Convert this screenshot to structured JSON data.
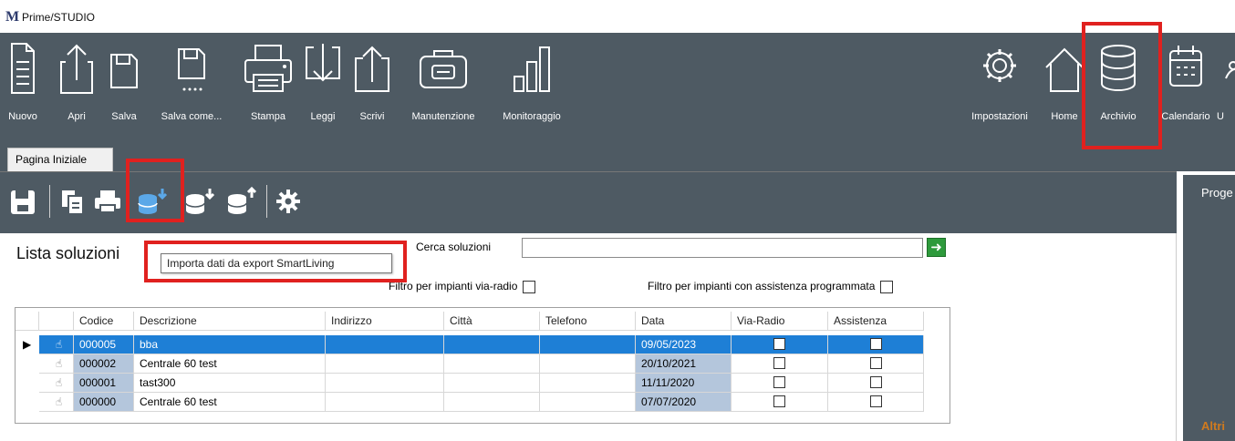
{
  "app": {
    "logo": "M",
    "title": "Prime/STUDIO"
  },
  "ribbon": {
    "left": [
      {
        "label": "Nuovo",
        "icon": "new-document-icon"
      },
      {
        "label": "Apri",
        "icon": "open-icon"
      },
      {
        "label": "Salva",
        "icon": "save-icon"
      },
      {
        "label": "Salva come...",
        "icon": "save-as-icon"
      },
      {
        "label": "Stampa",
        "icon": "printer-icon"
      },
      {
        "label": "Leggi",
        "icon": "read-icon"
      },
      {
        "label": "Scrivi",
        "icon": "write-icon"
      },
      {
        "label": "Manutenzione",
        "icon": "toolbox-icon"
      },
      {
        "label": "Monitoraggio",
        "icon": "bar-chart-icon"
      }
    ],
    "right": [
      {
        "label": "Impostazioni",
        "icon": "gear-icon"
      },
      {
        "label": "Home",
        "icon": "home-icon"
      },
      {
        "label": "Archivio",
        "icon": "database-icon"
      },
      {
        "label": "Calendario",
        "icon": "calendar-icon"
      },
      {
        "label": "U",
        "icon": "user-icon"
      }
    ]
  },
  "tabs": {
    "active": "Pagina Iniziale"
  },
  "toolbar2": {
    "tooltip": "Importa dati da export SmartLiving"
  },
  "right_panel": {
    "title": "Proge",
    "footer": "Altri"
  },
  "list": {
    "title": "Lista soluzioni",
    "search_label": "Cerca soluzioni",
    "search_value": "",
    "filter_radio": "Filtro per impianti via-radio",
    "filter_assist": "Filtro per impianti con assistenza programmata"
  },
  "table": {
    "headers": [
      "Codice",
      "Descrizione",
      "Indirizzo",
      "Città",
      "Telefono",
      "Data",
      "Via-Radio",
      "Assistenza"
    ],
    "rows": [
      {
        "codice": "000005",
        "descrizione": "bba",
        "indirizzo": "",
        "citta": "",
        "telefono": "",
        "data": "09/05/2023",
        "via_radio": false,
        "assistenza": false,
        "selected": true
      },
      {
        "codice": "000002",
        "descrizione": "Centrale 60 test",
        "indirizzo": "",
        "citta": "",
        "telefono": "",
        "data": "20/10/2021",
        "via_radio": false,
        "assistenza": false,
        "selected": false
      },
      {
        "codice": "000001",
        "descrizione": "tast300",
        "indirizzo": "",
        "citta": "",
        "telefono": "",
        "data": "11/11/2020",
        "via_radio": false,
        "assistenza": false,
        "selected": false
      },
      {
        "codice": "000000",
        "descrizione": "Centrale 60 test",
        "indirizzo": "",
        "citta": "",
        "telefono": "",
        "data": "07/07/2020",
        "via_radio": false,
        "assistenza": false,
        "selected": false
      }
    ]
  },
  "colors": {
    "ribbon": "#4e5a63",
    "selection": "#1e7fd6",
    "highlight": "#e0211f",
    "go_button": "#2e9a3c"
  }
}
